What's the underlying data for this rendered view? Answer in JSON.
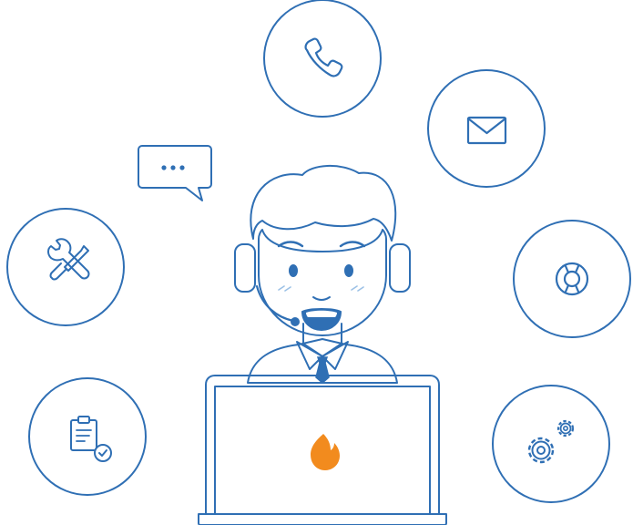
{
  "illustration": {
    "subject": "support-agent",
    "stroke_color": "#2f6fb4",
    "fill_light": "#e9f1fa",
    "accent_color": "#f28b1e",
    "icons": [
      "phone-icon",
      "mail-icon",
      "chat-bubble-icon",
      "tools-icon",
      "lifebuoy-icon",
      "clipboard-check-icon",
      "gears-icon",
      "flame-logo-icon"
    ]
  }
}
